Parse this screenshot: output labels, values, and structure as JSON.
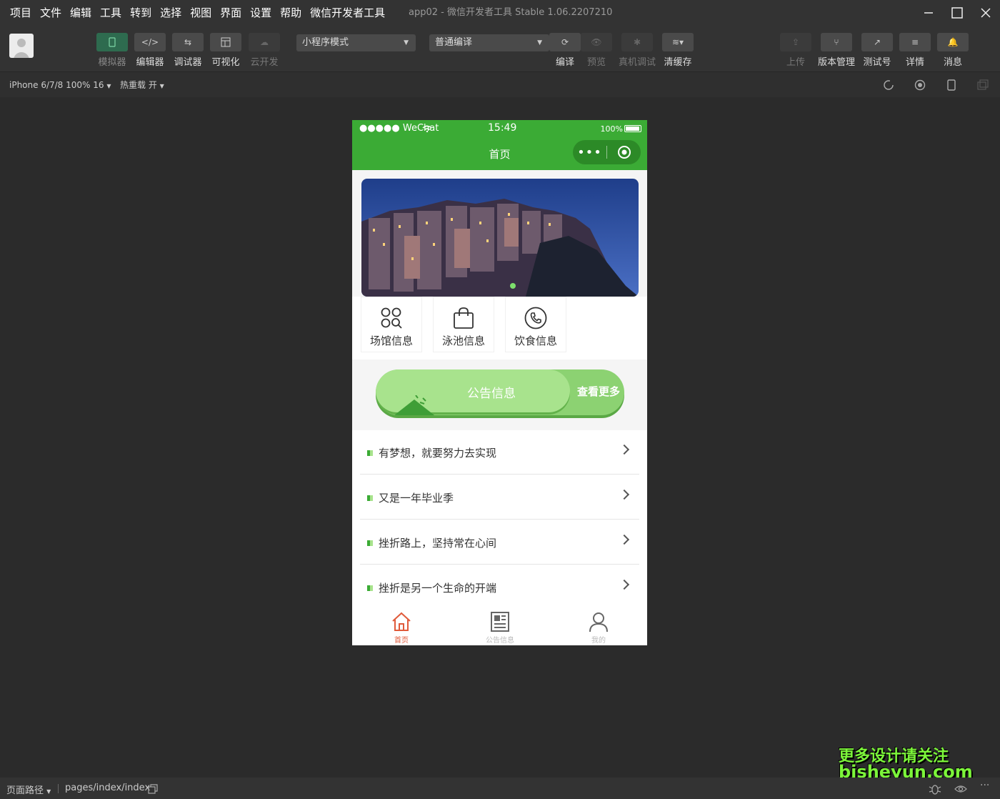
{
  "menu": [
    "项目",
    "文件",
    "编辑",
    "工具",
    "转到",
    "选择",
    "视图",
    "界面",
    "设置",
    "帮助",
    "微信开发者工具"
  ],
  "window_title": "app02 - 微信开发者工具 Stable 1.06.2207210",
  "toolbar": {
    "simulator": "模拟器",
    "editor": "编辑器",
    "debugger": "调试器",
    "visual": "可视化",
    "cloud": "云开发",
    "mode_select": "小程序模式",
    "compile_select": "普通编译",
    "compile": "编译",
    "preview": "预览",
    "real_debug": "真机调试",
    "clear_cache": "清缓存",
    "upload": "上传",
    "version": "版本管理",
    "test_account": "测试号",
    "details": "详情",
    "messages": "消息"
  },
  "subbar": {
    "device": "iPhone 6/7/8 100% 16",
    "hot_reload": "热重载 开"
  },
  "phone": {
    "status_left": "●●●●● WeChat",
    "time": "15:49",
    "battery": "100%",
    "nav_title": "首页",
    "categories": [
      "场馆信息",
      "泳池信息",
      "饮食信息"
    ],
    "notice_title": "公告信息",
    "notice_more": "查看更多",
    "news": [
      "有梦想，就要努力去实现",
      "又是一年毕业季",
      "挫折路上，坚持常在心间",
      "挫折是另一个生命的开端"
    ],
    "tabs": [
      "首页",
      "公告信息",
      "我的"
    ]
  },
  "watermark": {
    "line1": "更多设计请关注",
    "line2": "bisheyun.com"
  },
  "bottom": {
    "path_label": "页面路径",
    "path": "pages/index/index"
  }
}
